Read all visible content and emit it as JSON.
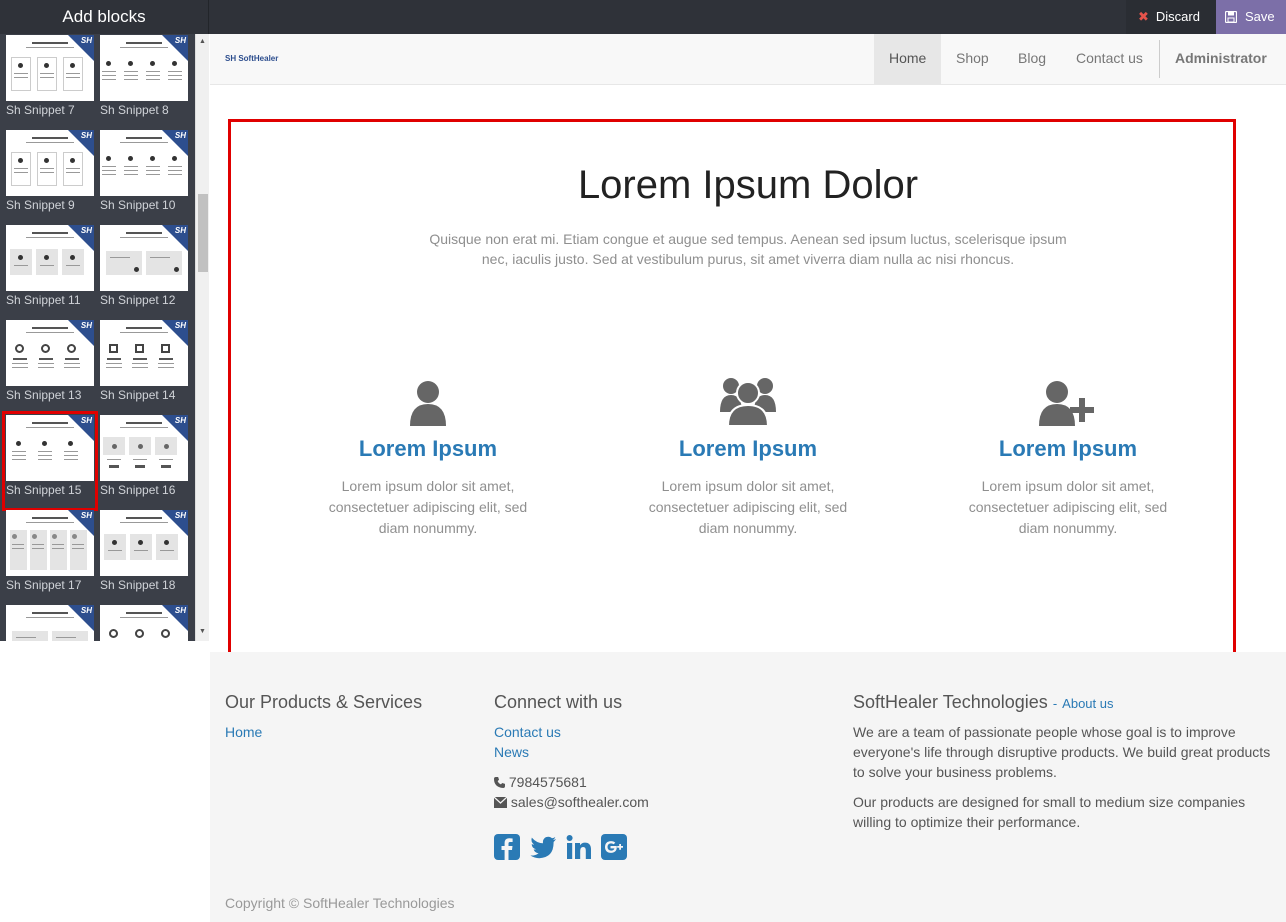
{
  "editor": {
    "panel_title": "Add blocks",
    "discard_label": "Discard",
    "save_label": "Save"
  },
  "snippets": [
    {
      "label": "Sh Snippet 7"
    },
    {
      "label": "Sh Snippet 8"
    },
    {
      "label": "Sh Snippet 9"
    },
    {
      "label": "Sh Snippet 10"
    },
    {
      "label": "Sh Snippet 11"
    },
    {
      "label": "Sh Snippet 12"
    },
    {
      "label": "Sh Snippet 13"
    },
    {
      "label": "Sh Snippet 14"
    },
    {
      "label": "Sh Snippet 15"
    },
    {
      "label": "Sh Snippet 16"
    },
    {
      "label": "Sh Snippet 17"
    },
    {
      "label": "Sh Snippet 18"
    },
    {
      "label": ""
    },
    {
      "label": ""
    }
  ],
  "selected_snippet": "Sh Snippet 15",
  "snippet_badge": "SH",
  "navbar": {
    "logo": "SH SoftHealer",
    "items": [
      "Home",
      "Shop",
      "Blog",
      "Contact us"
    ],
    "active": "Home",
    "user": "Administrator"
  },
  "hero": {
    "title": "Lorem Ipsum Dolor",
    "subtitle": "Quisque non erat mi. Etiam congue et augue sed tempus. Aenean sed ipsum luctus, scelerisque ipsum nec, iaculis justo. Sed at vestibulum purus, sit amet viverra diam nulla ac nisi rhoncus."
  },
  "features": [
    {
      "icon": "user-icon",
      "title": "Lorem Ipsum",
      "text": "Lorem ipsum dolor sit amet, consectetuer adipiscing elit, sed diam nonummy."
    },
    {
      "icon": "users-icon",
      "title": "Lorem Ipsum",
      "text": "Lorem ipsum dolor sit amet, consectetuer adipiscing elit, sed diam nonummy."
    },
    {
      "icon": "user-plus-icon",
      "title": "Lorem Ipsum",
      "text": "Lorem ipsum dolor sit amet, consectetuer adipiscing elit, sed diam nonummy."
    }
  ],
  "footer": {
    "products_title": "Our Products & Services",
    "products_links": [
      "Home"
    ],
    "connect_title": "Connect with us",
    "connect_links": [
      "Contact us",
      "News"
    ],
    "phone": "7984575681",
    "email": "sales@softhealer.com",
    "company_title": "SoftHealer Technologies",
    "about_link": "About us",
    "about_dash": "-",
    "about_p1": "We are a team of passionate people whose goal is to improve everyone's life through disruptive products. We build great products to solve your business problems.",
    "about_p2": "Our products are designed for small to medium size companies willing to optimize their performance.",
    "social": [
      "facebook-icon",
      "twitter-icon",
      "linkedin-icon",
      "google-plus-icon"
    ],
    "copyright": "Copyright © SoftHealer Technologies"
  },
  "colors": {
    "accent": "#2a7ab5",
    "highlight": "#e00000",
    "save": "#7c6fa8",
    "topbar": "#2f3239",
    "sidebar": "#3b3f48"
  }
}
